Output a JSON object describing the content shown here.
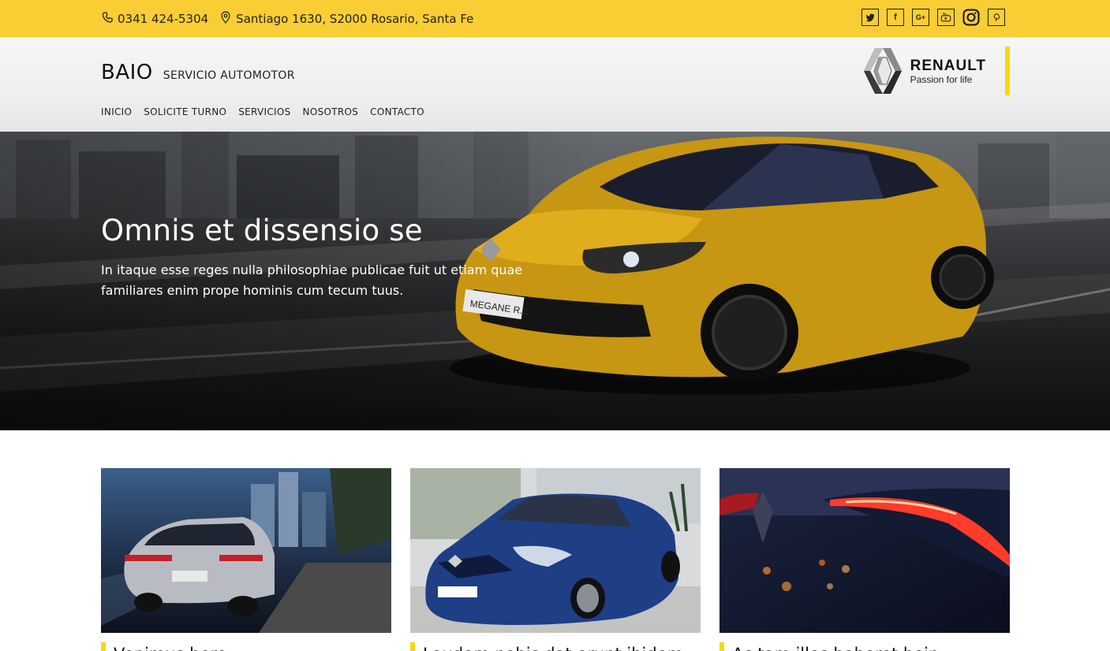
{
  "topbar": {
    "phone": "0341 424-5304",
    "address": "Santiago 1630, S2000 Rosario, Santa Fe",
    "socials": [
      {
        "icon": "twitter-icon",
        "glyph": ""
      },
      {
        "icon": "facebook-icon",
        "glyph": "f"
      },
      {
        "icon": "google-plus-icon",
        "glyph": "G+"
      },
      {
        "icon": "youtube-icon",
        "glyph": ""
      },
      {
        "icon": "instagram-icon",
        "glyph": ""
      },
      {
        "icon": "pinterest-icon",
        "glyph": "P"
      }
    ],
    "bg_color": "#f9cd34"
  },
  "header": {
    "brand": "BAIO",
    "brand_sub": "SERVICIO AUTOMOTOR",
    "nav": [
      "INICIO",
      "SOLICITE TURNO",
      "SERVICIOS",
      "NOSOTROS",
      "CONTACTO"
    ],
    "logo": {
      "name": "RENAULT",
      "tagline": "Passion for life"
    },
    "accent": "#f5d90f"
  },
  "hero": {
    "title": "Omnis et dissensio se",
    "text": "In itaque esse reges nulla philosophiae publicae fuit ut etiam quae familiares enim prope hominis cum tecum tuus.",
    "plate": "MEGANE R.S."
  },
  "cards": [
    {
      "title": "Venimus here...",
      "image": "silver-hatchback-city-night"
    },
    {
      "title": "Laudem nobis dat erunt ibidem",
      "image": "blue-megane-front"
    },
    {
      "title": "Ac tam illos haberet bein",
      "image": "red-taillight-closeup"
    }
  ]
}
